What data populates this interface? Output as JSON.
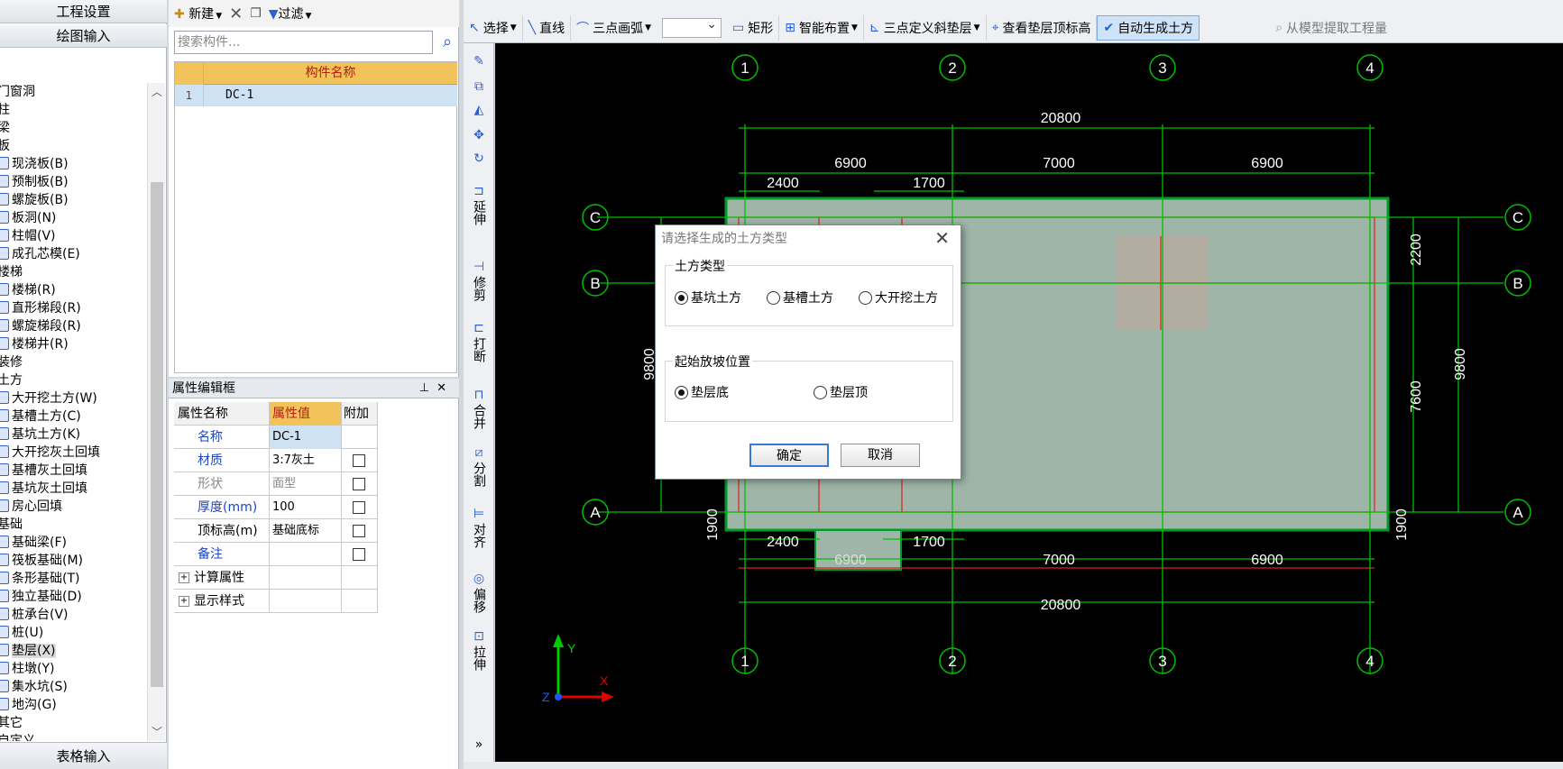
{
  "left_nav": {
    "project_settings": "工程设置",
    "drawing_input": "绘图输入",
    "table_input": "表格输入",
    "tree": [
      {
        "label": "门窗洞",
        "kind": "cat"
      },
      {
        "label": "柱",
        "kind": "cat"
      },
      {
        "label": "梁",
        "kind": "cat"
      },
      {
        "label": "板",
        "kind": "cat"
      },
      {
        "label": "现浇板(B)",
        "kind": "sub"
      },
      {
        "label": "预制板(B)",
        "kind": "sub"
      },
      {
        "label": "螺旋板(B)",
        "kind": "sub"
      },
      {
        "label": "板洞(N)",
        "kind": "sub"
      },
      {
        "label": "柱帽(V)",
        "kind": "sub"
      },
      {
        "label": "成孔芯模(E)",
        "kind": "sub"
      },
      {
        "label": "楼梯",
        "kind": "cat"
      },
      {
        "label": "楼梯(R)",
        "kind": "sub"
      },
      {
        "label": "直形梯段(R)",
        "kind": "sub"
      },
      {
        "label": "螺旋梯段(R)",
        "kind": "sub"
      },
      {
        "label": "楼梯井(R)",
        "kind": "sub"
      },
      {
        "label": "装修",
        "kind": "cat"
      },
      {
        "label": "土方",
        "kind": "cat"
      },
      {
        "label": "大开挖土方(W)",
        "kind": "sub"
      },
      {
        "label": "基槽土方(C)",
        "kind": "sub"
      },
      {
        "label": "基坑土方(K)",
        "kind": "sub"
      },
      {
        "label": "大开挖灰土回填",
        "kind": "sub"
      },
      {
        "label": "基槽灰土回填",
        "kind": "sub"
      },
      {
        "label": "基坑灰土回填",
        "kind": "sub"
      },
      {
        "label": "房心回填",
        "kind": "sub"
      },
      {
        "label": "基础",
        "kind": "cat"
      },
      {
        "label": "基础梁(F)",
        "kind": "sub"
      },
      {
        "label": "筏板基础(M)",
        "kind": "sub"
      },
      {
        "label": "条形基础(T)",
        "kind": "sub"
      },
      {
        "label": "独立基础(D)",
        "kind": "sub"
      },
      {
        "label": "桩承台(V)",
        "kind": "sub"
      },
      {
        "label": "桩(U)",
        "kind": "sub"
      },
      {
        "label": "垫层(X)",
        "kind": "sub",
        "selected": true
      },
      {
        "label": "柱墩(Y)",
        "kind": "sub"
      },
      {
        "label": "集水坑(S)",
        "kind": "sub"
      },
      {
        "label": "地沟(G)",
        "kind": "sub"
      },
      {
        "label": "其它",
        "kind": "cat"
      },
      {
        "label": "自定义",
        "kind": "cat"
      }
    ]
  },
  "component_panel": {
    "new_label": "新建",
    "filter_label": "过滤",
    "search_placeholder": "搜索构件...",
    "col_name": "构件名称",
    "rows": [
      {
        "index": "1",
        "name": "DC-1"
      }
    ]
  },
  "property_panel": {
    "title": "属性编辑框",
    "headers": {
      "name": "属性名称",
      "value": "属性值",
      "extra": "附加"
    },
    "rows": [
      {
        "name": "名称",
        "value": "DC-1",
        "style": "blue",
        "check": false
      },
      {
        "name": "材质",
        "value": "3:7灰土",
        "style": "blue",
        "check": true
      },
      {
        "name": "形状",
        "value": "面型",
        "style": "gray",
        "check": true
      },
      {
        "name": "厚度(mm)",
        "value": "100",
        "style": "blue",
        "check": true
      },
      {
        "name": "顶标高(m)",
        "value": "基础底标",
        "style": "plain",
        "check": true
      },
      {
        "name": "备注",
        "value": "",
        "style": "blue",
        "check": true
      },
      {
        "name": "计算属性",
        "value": "",
        "style": "group",
        "check": false
      },
      {
        "name": "显示样式",
        "value": "",
        "style": "group",
        "check": false
      }
    ]
  },
  "toolbar": {
    "select": "选择",
    "line": "直线",
    "arc": "三点画弧",
    "rect": "矩形",
    "smart": "智能布置",
    "slope": "三点定义斜垫层",
    "view_top": "查看垫层顶标高",
    "auto_earth": "自动生成土方",
    "extract": "从模型提取工程量"
  },
  "side_toolbar": [
    "延伸",
    "修剪",
    "打断",
    "合并",
    "分割",
    "对齐",
    "偏移",
    "拉伸"
  ],
  "drawing": {
    "axes_top": [
      "1",
      "2",
      "3",
      "4"
    ],
    "axes_side": [
      "C",
      "B",
      "A"
    ],
    "dims": {
      "total": "20800",
      "spans": [
        "6900",
        "7000",
        "6900"
      ],
      "left_top": "2400",
      "mid_top": "1700",
      "left_bottom": "2400",
      "mid_bottom": "1700",
      "bottom_spans": [
        "6900",
        "7000",
        "6900"
      ],
      "left_total": "9800",
      "right_total": "9800",
      "right_top": "2200",
      "right_mid": "7600",
      "edge_left": "1900",
      "edge_right": "1900"
    },
    "axis_x": "X",
    "axis_y": "Y",
    "axis_z": "Z"
  },
  "dialog": {
    "title": "请选择生成的土方类型",
    "group1": "土方类型",
    "opt_pit": "基坑土方",
    "opt_trench": "基槽土方",
    "opt_open": "大开挖土方",
    "group2": "起始放坡位置",
    "opt_bottom": "垫层底",
    "opt_top": "垫层顶",
    "ok": "确定",
    "cancel": "取消"
  },
  "colors": {
    "canvas": "#000000",
    "grid": "#00c000",
    "slab": "#9fb5a8",
    "red": "#e02020",
    "accent": "#3a78d6"
  }
}
